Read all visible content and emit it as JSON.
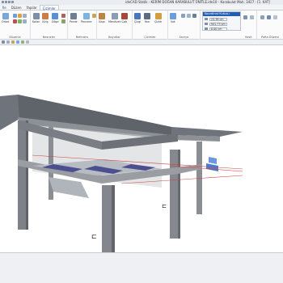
{
  "window": {
    "title": "ideCAD Statik - KERİM DOĞAN KARABULUT ÜNİTLE.ide10 - Karabulut Mah. 3427 - [1. KAT]"
  },
  "tabs": [
    {
      "label": "İle"
    },
    {
      "label": "Düzen"
    },
    {
      "label": "Yapılar"
    },
    {
      "label": "Çizimler"
    }
  ],
  "ribbon": {
    "buttons": {
      "ortak": "Ortak",
      "kolon": "Kolon",
      "kiris": "Kiriş",
      "dose": "Döşe",
      "perde": "Perde",
      "pencere": "Pencere",
      "kapi": "Kapı",
      "merdiven": "Merdiven",
      "cati": "Çatı",
      "cizgi": "Çizgi",
      "yazi": "Yazı",
      "cizim": "Çizim",
      "kot": "Kot"
    },
    "groups": {
      "duzenle": "Düzenle",
      "nesneler": "Nesneler",
      "referans": "Referans",
      "boyutlar": "Boyutlar",
      "cizimler": "Çizimler",
      "seviye": "Seviye",
      "kesit": "Kesit",
      "pafta": "Pafta Düzeni"
    }
  },
  "coord_box": {
    "title": "Koordinat Kutusu",
    "x_value": "24.36 cm",
    "y_value": "941.73 cm",
    "z_value": "0.00 cm"
  },
  "viewport": {
    "label_1": "⊏",
    "label_2": "⊏"
  }
}
